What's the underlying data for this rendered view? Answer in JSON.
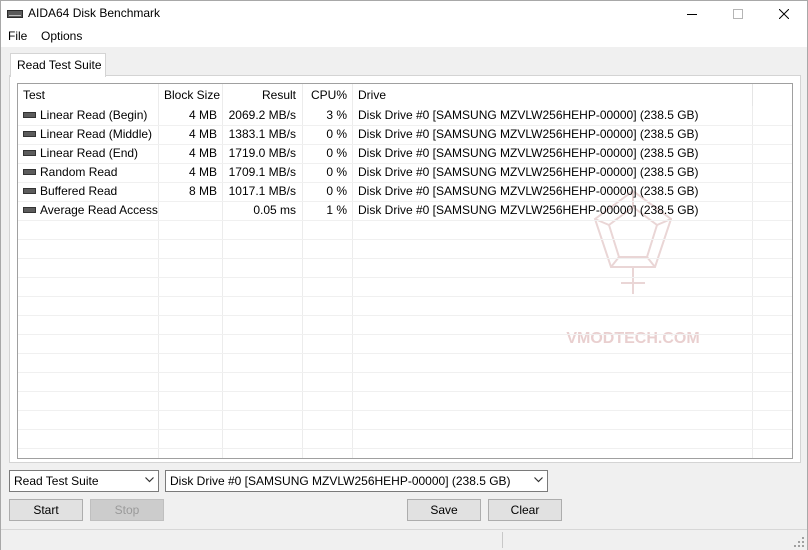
{
  "window": {
    "title": "AIDA64 Disk Benchmark",
    "icon": "hard-drive-icon"
  },
  "menu": {
    "items": [
      "File",
      "Options"
    ]
  },
  "tab": {
    "label": "Read Test Suite"
  },
  "table": {
    "columns": [
      "Test",
      "Block Size",
      "Result",
      "CPU%",
      "Drive"
    ],
    "rows": [
      {
        "test": "Linear Read (Begin)",
        "block": "4 MB",
        "result": "2069.2 MB/s",
        "cpu": "3 %",
        "drive": "Disk Drive #0  [SAMSUNG MZVLW256HEHP-00000]  (238.5 GB)"
      },
      {
        "test": "Linear Read (Middle)",
        "block": "4 MB",
        "result": "1383.1 MB/s",
        "cpu": "0 %",
        "drive": "Disk Drive #0  [SAMSUNG MZVLW256HEHP-00000]  (238.5 GB)"
      },
      {
        "test": "Linear Read (End)",
        "block": "4 MB",
        "result": "1719.0 MB/s",
        "cpu": "0 %",
        "drive": "Disk Drive #0  [SAMSUNG MZVLW256HEHP-00000]  (238.5 GB)"
      },
      {
        "test": "Random Read",
        "block": "4 MB",
        "result": "1709.1 MB/s",
        "cpu": "0 %",
        "drive": "Disk Drive #0  [SAMSUNG MZVLW256HEHP-00000]  (238.5 GB)"
      },
      {
        "test": "Buffered Read",
        "block": "8 MB",
        "result": "1017.1 MB/s",
        "cpu": "0 %",
        "drive": "Disk Drive #0  [SAMSUNG MZVLW256HEHP-00000]  (238.5 GB)"
      },
      {
        "test": "Average Read Access",
        "block": "",
        "result": "0.05 ms",
        "cpu": "1 %",
        "drive": "Disk Drive #0  [SAMSUNG MZVLW256HEHP-00000]  (238.5 GB)"
      }
    ]
  },
  "watermark": {
    "text": "VMODTECH.COM"
  },
  "controls": {
    "suite_select": "Read Test Suite",
    "drive_select": "Disk Drive #0  [SAMSUNG MZVLW256HEHP-00000]  (238.5 GB)",
    "start": "Start",
    "stop": "Stop",
    "save": "Save",
    "clear": "Clear"
  },
  "colors": {
    "watermark": "#e9cfcf",
    "disabled_text": "#9a9a9a"
  }
}
